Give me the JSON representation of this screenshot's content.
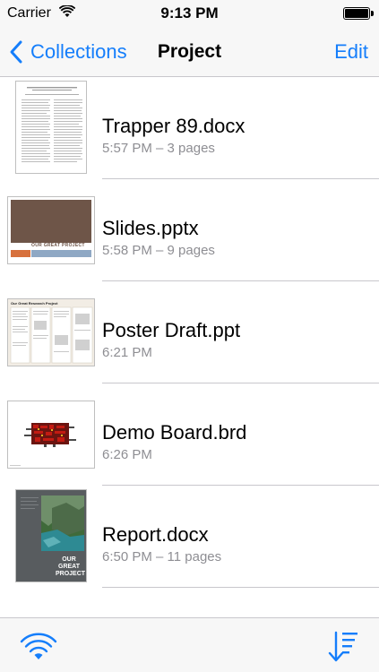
{
  "status_bar": {
    "carrier": "Carrier",
    "time": "9:13 PM",
    "wifi_icon": "wifi-icon",
    "battery_icon": "battery-icon"
  },
  "nav": {
    "back_label": "Collections",
    "title": "Project",
    "edit_label": "Edit",
    "accent_color": "#157efb"
  },
  "files": [
    {
      "name": "Trapper 89.docx",
      "meta": "5:57 PM – 3 pages",
      "kind": "document"
    },
    {
      "name": "Slides.pptx",
      "meta": "5:58 PM – 9 pages",
      "kind": "presentation",
      "thumb_caption": "OUR GREAT PROJECT"
    },
    {
      "name": "Poster Draft.ppt",
      "meta": "6:21 PM",
      "kind": "poster",
      "thumb_caption": "Our Great Research Project"
    },
    {
      "name": "Demo Board.brd",
      "meta": "6:26 PM",
      "kind": "circuit-board"
    },
    {
      "name": "Report.docx",
      "meta": "6:50 PM – 11 pages",
      "kind": "report",
      "thumb_caption": "OUR GREAT PROJECT"
    }
  ],
  "toolbar": {
    "left_icon": "wifi-share-icon",
    "right_icon": "sort-icon"
  },
  "colors": {
    "secondary_text": "#8e8e93",
    "separator": "#c8c7cc",
    "bar_background": "#f7f7f7"
  }
}
